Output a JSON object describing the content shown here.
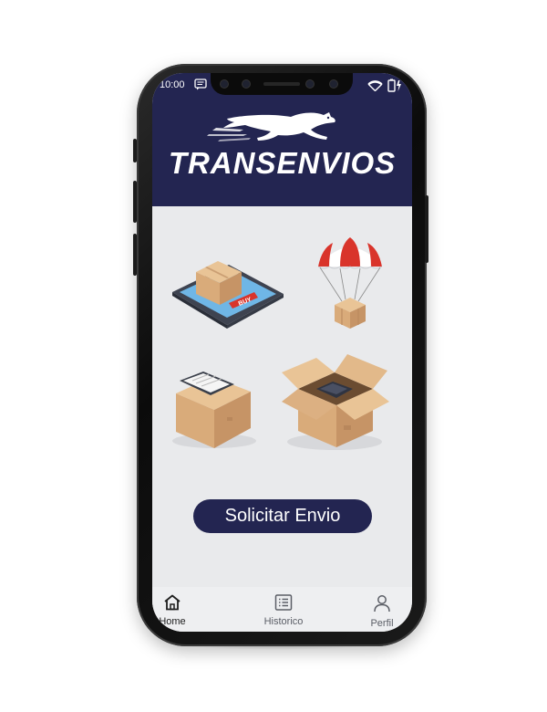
{
  "status_bar": {
    "time": "10:00",
    "message_icon": "message-icon",
    "wifi_icon": "wifi-icon",
    "battery_icon": "battery-charging-icon"
  },
  "header": {
    "brand": "TRANSENVIOS",
    "logo_icon": "running-cat-logo"
  },
  "main": {
    "illustrations": [
      {
        "name": "tablet-buy-box-illustration",
        "text": "BUY"
      },
      {
        "name": "parachute-box-illustration"
      },
      {
        "name": "clipboard-box-illustration"
      },
      {
        "name": "open-box-illustration"
      }
    ],
    "cta_label": "Solicitar Envio"
  },
  "bottom_nav": {
    "items": [
      {
        "label": "Home",
        "icon": "home-icon",
        "active": true
      },
      {
        "label": "Historico",
        "icon": "list-icon",
        "active": false
      },
      {
        "label": "Perfil",
        "icon": "user-icon",
        "active": false
      }
    ]
  },
  "colors": {
    "brand_navy": "#232551",
    "screen_bg": "#e9eaec",
    "accent_red": "#d9342b",
    "box_tan": "#d9ab7a"
  }
}
